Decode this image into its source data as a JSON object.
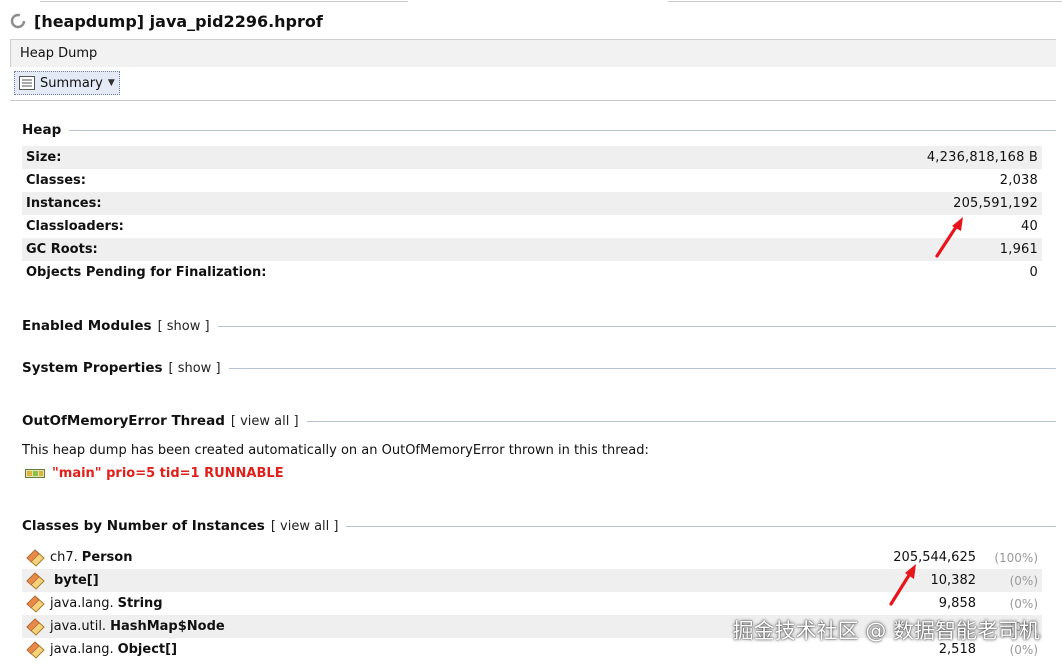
{
  "window": {
    "title": "[heapdump] java_pid2296.hprof"
  },
  "tab": {
    "label": "Heap Dump"
  },
  "toolbar": {
    "view_selected": "Summary"
  },
  "heap": {
    "title": "Heap",
    "rows": [
      {
        "label": "Size:",
        "value": "4,236,818,168 B"
      },
      {
        "label": "Classes:",
        "value": "2,038"
      },
      {
        "label": "Instances:",
        "value": "205,591,192"
      },
      {
        "label": "Classloaders:",
        "value": "40"
      },
      {
        "label": "GC Roots:",
        "value": "1,961"
      },
      {
        "label": "Objects Pending for Finalization:",
        "value": "0"
      }
    ]
  },
  "enabled_modules": {
    "title": "Enabled Modules",
    "link": "[ show ]"
  },
  "system_properties": {
    "title": "System Properties",
    "link": "[ show ]"
  },
  "oom_thread": {
    "title": "OutOfMemoryError Thread",
    "link": "[ view all ]",
    "description": "This heap dump has been created automatically on an OutOfMemoryError thrown in this thread:",
    "thread": "\"main\" prio=5 tid=1 RUNNABLE"
  },
  "classes_by_instances": {
    "title": "Classes by Number of Instances",
    "link": "[ view all ]",
    "rows": [
      {
        "package": "ch7.",
        "name": "Person",
        "count": "205,544,625",
        "percent": "(100%)"
      },
      {
        "package": "",
        "name": "byte[]",
        "count": "10,382",
        "percent": "(0%)"
      },
      {
        "package": "java.lang.",
        "name": "String",
        "count": "9,858",
        "percent": "(0%)"
      },
      {
        "package": "java.util.",
        "name": "HashMap$Node",
        "count": "",
        "percent": "(0%)"
      },
      {
        "package": "java.lang.",
        "name": "Object[]",
        "count": "2,518",
        "percent": "(0%)"
      }
    ]
  },
  "watermark": "掘金技术社区 @ 数据智能老司机",
  "colors": {
    "accent_red": "#e0201a",
    "annotation_arrow": "#e8141c",
    "rule": "#b9c3d6"
  }
}
